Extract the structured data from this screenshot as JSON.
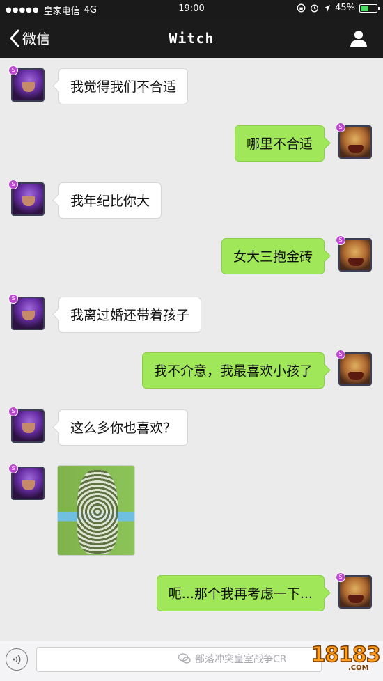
{
  "status_bar": {
    "carrier": "皇家电信",
    "network": "4G",
    "time": "19:00",
    "battery_percent": "45%",
    "battery_level": 0.45
  },
  "nav": {
    "back_label": "微信",
    "title": "Witch"
  },
  "messages": [
    {
      "side": "left",
      "text": "我觉得我们不合适",
      "avatar": "witch"
    },
    {
      "side": "right",
      "text": "哪里不合适",
      "avatar": "hog-rider"
    },
    {
      "side": "left",
      "text": "我年纪比你大",
      "avatar": "witch"
    },
    {
      "side": "right",
      "text": "女大三抱金砖",
      "avatar": "hog-rider"
    },
    {
      "side": "left",
      "text": "我离过婚还带着孩子",
      "avatar": "witch"
    },
    {
      "side": "right",
      "text": "我不介意，我最喜欢小孩了",
      "avatar": "hog-rider"
    },
    {
      "side": "left",
      "text": "这么多你也喜欢？",
      "avatar": "witch"
    },
    {
      "side": "left",
      "type": "image",
      "avatar": "witch"
    },
    {
      "side": "right",
      "text": "呃...那个我再考虑一下...",
      "avatar": "hog-rider"
    }
  ],
  "input_bar": {
    "watermark": "部落冲突皇室战争CR",
    "logo": "18183",
    "logo_suffix": ".COM"
  },
  "colors": {
    "sent_bubble": "#a0e75a",
    "received_bubble": "#ffffff",
    "chat_background": "#ebebeb",
    "header": "#1b1b1b"
  },
  "icons": {
    "back": "chevron-left-icon",
    "profile": "person-icon",
    "voice": "voice-icon",
    "wechat_watermark": "wechat-icon"
  }
}
